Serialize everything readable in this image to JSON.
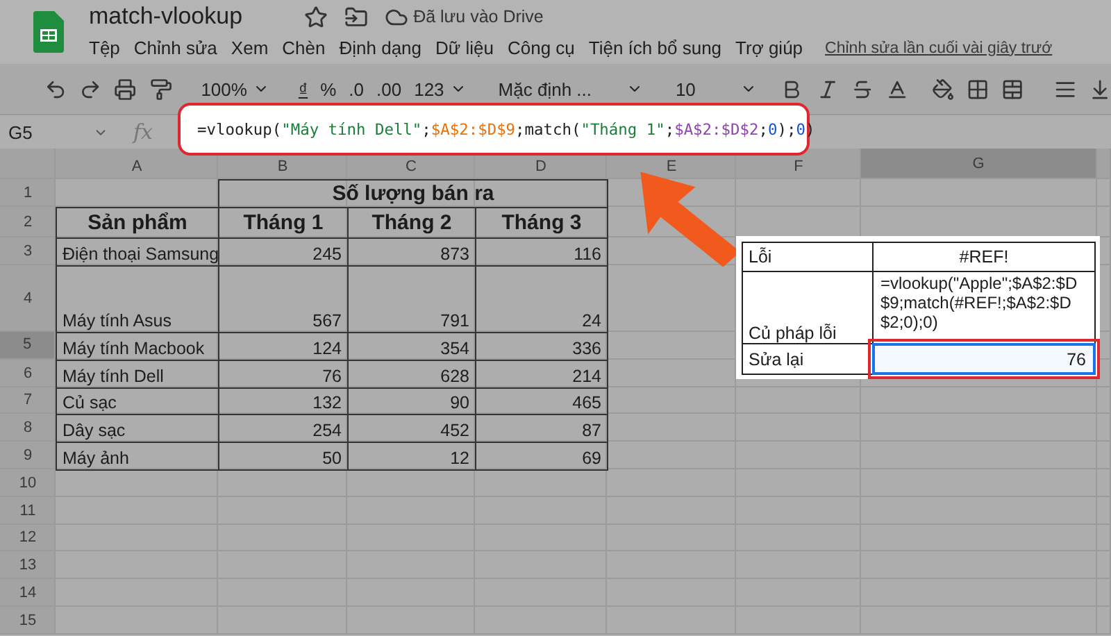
{
  "doc": {
    "title": "match-vlookup",
    "save_status": "Đã lưu vào Drive"
  },
  "menu": [
    "Tệp",
    "Chỉnh sửa",
    "Xem",
    "Chèn",
    "Định dạng",
    "Dữ liệu",
    "Công cụ",
    "Tiện ích bổ sung",
    "Trợ giúp"
  ],
  "last_edit": "Chỉnh sửa lần cuối vài giây trướ",
  "toolbar": {
    "zoom": "100%",
    "currency": "₫",
    "percent": "%",
    "decimal_less": ".0",
    "decimal_more": ".00",
    "number_format": "123",
    "font": "Mặc định ...",
    "font_size": "10"
  },
  "name_box": "G5",
  "fx": "fx",
  "formula": [
    {
      "kind": "text",
      "text": "=vlookup("
    },
    {
      "kind": "string",
      "text": "\"Máy tính Dell\""
    },
    {
      "kind": "text",
      "text": ";"
    },
    {
      "kind": "range_a",
      "text": "$A$2:$D$9"
    },
    {
      "kind": "text",
      "text": ";match("
    },
    {
      "kind": "string",
      "text": "\"Tháng 1\""
    },
    {
      "kind": "text",
      "text": ";"
    },
    {
      "kind": "range_b",
      "text": "$A$2:$D$2"
    },
    {
      "kind": "text",
      "text": ";"
    },
    {
      "kind": "number",
      "text": "0"
    },
    {
      "kind": "text",
      "text": ");"
    },
    {
      "kind": "number",
      "text": "0"
    },
    {
      "kind": "text",
      "text": ")"
    }
  ],
  "columns": [
    {
      "label": "A",
      "selected": false
    },
    {
      "label": "B",
      "selected": false
    },
    {
      "label": "C",
      "selected": false
    },
    {
      "label": "D",
      "selected": false
    },
    {
      "label": "E",
      "selected": false
    },
    {
      "label": "F",
      "selected": false
    },
    {
      "label": "G",
      "selected": true
    }
  ],
  "row_numbers": [
    {
      "label": "1",
      "selected": false
    },
    {
      "label": "2",
      "selected": false
    },
    {
      "label": "3",
      "selected": false
    },
    {
      "label": "4",
      "selected": false
    },
    {
      "label": "5",
      "selected": true
    },
    {
      "label": "6",
      "selected": false
    },
    {
      "label": "7",
      "selected": false
    },
    {
      "label": "8",
      "selected": false
    },
    {
      "label": "9",
      "selected": false
    },
    {
      "label": "10",
      "selected": false
    },
    {
      "label": "11",
      "selected": false
    },
    {
      "label": "12",
      "selected": false
    },
    {
      "label": "13",
      "selected": false
    },
    {
      "label": "14",
      "selected": false
    },
    {
      "label": "15",
      "selected": false
    }
  ],
  "table": {
    "title": "Số lượng bán ra",
    "header": [
      "Sản phẩm",
      "Tháng 1",
      "Tháng 2",
      "Tháng 3"
    ],
    "rows": [
      [
        "Điện thoại Samsung",
        "245",
        "873",
        "116"
      ],
      [
        "Máy tính Asus",
        "567",
        "791",
        "24"
      ],
      [
        "Máy tính Macbook",
        "124",
        "354",
        "336"
      ],
      [
        "Máy tính Dell",
        "76",
        "628",
        "214"
      ],
      [
        "Củ sạc",
        "132",
        "90",
        "465"
      ],
      [
        "Dây sạc",
        "254",
        "452",
        "87"
      ],
      [
        "Máy ảnh",
        "50",
        "12",
        "69"
      ]
    ]
  },
  "inset": [
    {
      "label": "Lỗi",
      "value": "#REF!",
      "selected": false
    },
    {
      "label": "Củ pháp lỗi",
      "value": "=vlookup(\"Apple\";$A$2:$D$9;match(#REF!;$A$2:$D$2;0);0)",
      "selected": false
    },
    {
      "label": "Sửa lại",
      "value": "76",
      "selected": true
    }
  ]
}
